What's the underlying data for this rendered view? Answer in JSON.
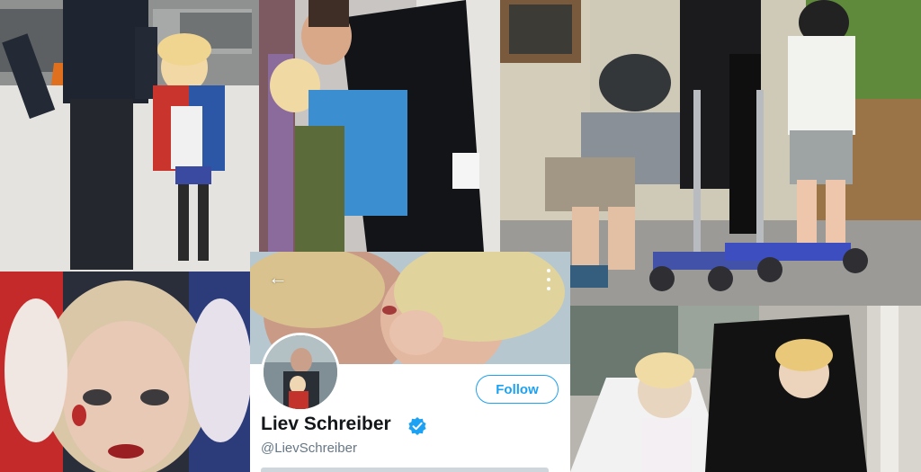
{
  "profile": {
    "display_name": "Liev Schreiber",
    "handle": "@LievSchreiber",
    "follow_label": "Follow",
    "back_arrow": "←",
    "verified_color": "#1da1f2"
  },
  "photos": [
    {
      "id": "street-photo",
      "description_icon": "photo-icon"
    },
    {
      "id": "kiss-photo",
      "description_icon": "photo-icon"
    },
    {
      "id": "scooter-photo",
      "description_icon": "photo-icon"
    },
    {
      "id": "costume-closeup-photo",
      "description_icon": "photo-icon"
    },
    {
      "id": "halloween-photo",
      "description_icon": "photo-icon"
    }
  ],
  "colors": {
    "accent": "#1da1f2",
    "name_text": "#14171a",
    "handle_text": "#657786"
  }
}
